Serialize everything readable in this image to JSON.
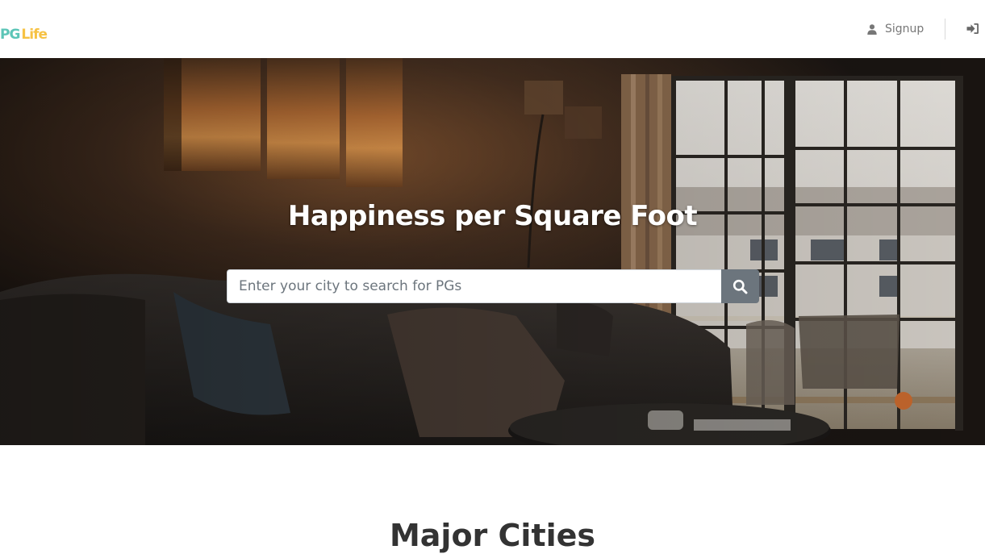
{
  "brand": {
    "logo_part1": "PG",
    "logo_part2": "Life"
  },
  "nav": {
    "signup_label": "Signup",
    "signup_icon": "user-icon",
    "login_icon": "sign-in-icon"
  },
  "hero": {
    "title": "Happiness per Square Foot",
    "search_placeholder": "Enter your city to search for PGs",
    "search_value": "",
    "search_icon": "search-icon"
  },
  "cities": {
    "section_title": "Major Cities"
  },
  "colors": {
    "brand_teal": "#5cc5b7",
    "brand_yellow": "#f6c244",
    "search_button": "#6c757d"
  }
}
